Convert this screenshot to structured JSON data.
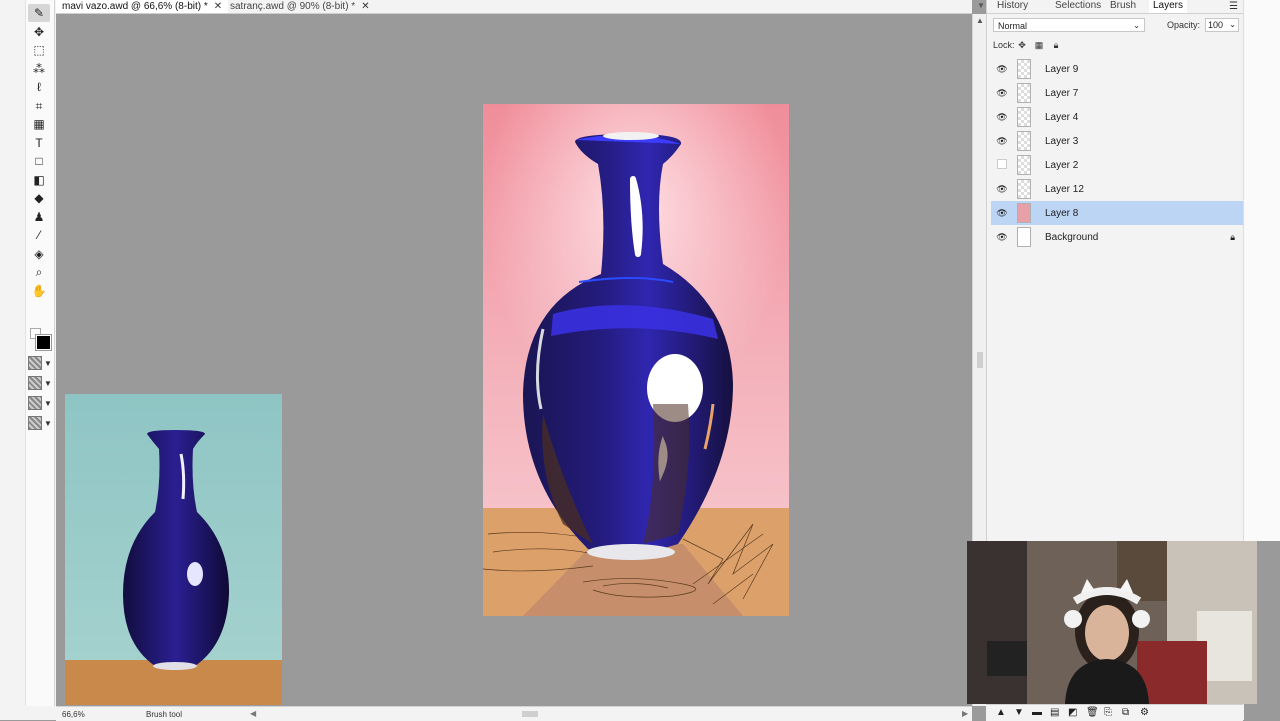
{
  "document_tabs": [
    {
      "label": "mavi vazo.awd @ 66,6% (8-bit) *",
      "active": true
    },
    {
      "label": "satranç.awd @ 90% (8-bit) *",
      "active": false
    }
  ],
  "status": {
    "zoom": "66,6%",
    "tool": "Brush tool"
  },
  "panel_tabs": [
    "History",
    "Selections",
    "Brush",
    "Layers"
  ],
  "layers_panel": {
    "blend_mode": "Normal",
    "opacity_label": "Opacity:",
    "opacity_value": "100",
    "lock_label": "Lock:"
  },
  "layers": [
    {
      "name": "Layer 9",
      "visible": true
    },
    {
      "name": "Layer 7",
      "visible": true
    },
    {
      "name": "Layer 4",
      "visible": true
    },
    {
      "name": "Layer 3",
      "visible": true
    },
    {
      "name": "Layer 2",
      "visible": false
    },
    {
      "name": "Layer 12",
      "visible": true
    },
    {
      "name": "Layer 8",
      "visible": true,
      "selected": true
    },
    {
      "name": "Background",
      "visible": true,
      "locked": true
    }
  ],
  "colors": {
    "foreground": "#000000",
    "background": "#ffffff",
    "selection": "#bcd5f5"
  }
}
